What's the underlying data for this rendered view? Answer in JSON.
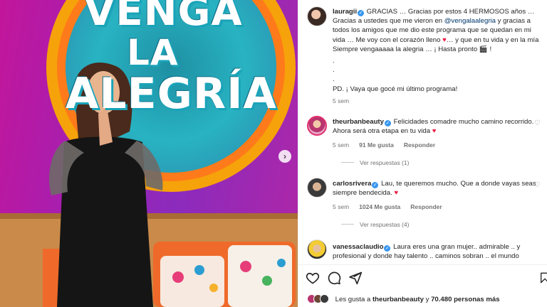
{
  "post": {
    "logo_line1": "VENGA",
    "logo_line2": "LA",
    "logo_line3": "ALEGRÍA",
    "carousel_next_icon": "chevron-right-icon"
  },
  "caption": {
    "username": "lauragii",
    "text_part1": "GRACIAS … Gracias por estos 4 HERMOSOS años … Gracias a ustedes que me vieron en ",
    "mention": "@vengalaalegria",
    "text_part2": " y gracias a todos los amigos que me dio este programa que se quedan en mi vida … Me voy con el corazón lleno ",
    "text_part3": "… y que en tu vida y en la mía Siempre vengaaaaa la alegria … ¡ Hasta pronto ",
    "text_end": " !",
    "dot1": ".",
    "dot2": ".",
    "dot3": ".",
    "postscript": "PD. ¡ Vaya que gocé mi último programa!",
    "time": "5 sem"
  },
  "comments": [
    {
      "username": "theurbanbeauty",
      "text": "Felicidades comadre mucho camino recorrido. Ahora será otra etapa en tu vida",
      "time": "5 sem",
      "likes": "91 Me gusta",
      "reply": "Responder",
      "view_replies": "Ver respuestas (1)"
    },
    {
      "username": "carlosrivera",
      "text": "Lau, te queremos mucho. Que a donde vayas seas siempre bendecida.",
      "time": "5 sem",
      "likes": "1024 Me gusta",
      "reply": "Responder",
      "view_replies": "Ver respuestas (4)"
    },
    {
      "username": "vanessaclaudio",
      "text": "Laura eres una gran mujer.. admirable .. y profesional y donde hay talento .. caminos sobran .. el mundo"
    }
  ],
  "likes_summary": {
    "prefix": "Les gusta a",
    "user": "theurbanbeauty",
    "middle": "y",
    "count": "70.480 personas más"
  },
  "icons": {
    "like": "heart-icon",
    "comment": "comment-icon",
    "share": "share-icon",
    "save": "bookmark-icon"
  },
  "colors": {
    "verified": "#3897f0",
    "heart": "#ed1c45",
    "mention": "#00376b",
    "muted": "#737373"
  }
}
